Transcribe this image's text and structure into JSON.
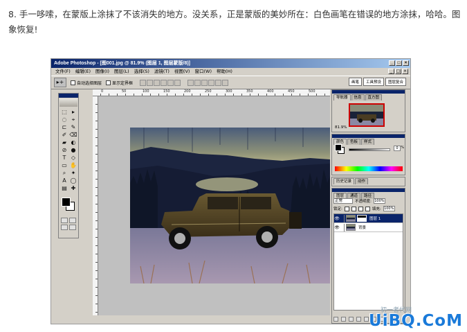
{
  "caption": "8. 手一哆嗦，在蒙版上涂抹了不该消失的地方。没关系，正是蒙版的美妙所在：白色画笔在错误的地方涂抹，哈哈。图象恢复!",
  "window": {
    "title": "Adobe Photoshop - [图001.jpg @ 81.9% (图层 1, 图层蒙版/8)]",
    "controls": [
      "_",
      "□",
      "×"
    ]
  },
  "menu": [
    "文件(F)",
    "编辑(E)",
    "图像(I)",
    "图层(L)",
    "选择(S)",
    "滤镜(T)",
    "视图(V)",
    "窗口(W)",
    "帮助(H)"
  ],
  "options_bar": {
    "tool_glyph": "▸+",
    "auto_select_label": "自动选择图层",
    "show_bounds_label": "显示定界框",
    "palette_well": [
      "画笔",
      "工具预设",
      "图层复合"
    ]
  },
  "tools": [
    "⬚",
    "▸",
    "◌",
    "⌖",
    "⊏",
    "✎",
    "✐",
    "⌫",
    "▰",
    "◐",
    "⊘",
    "●",
    "T",
    "◇",
    "▭",
    "✋",
    "⌕",
    "✦",
    "A",
    "◯",
    "▤",
    "✚"
  ],
  "ruler_ticks": [
    "0",
    "50",
    "100",
    "150",
    "200",
    "250",
    "300",
    "350",
    "400",
    "450",
    "500"
  ],
  "navigator": {
    "tabs": [
      "导航器",
      "信息",
      "直方图"
    ],
    "zoom": "81.9%"
  },
  "color_panel": {
    "tabs": [
      "颜色",
      "色板",
      "样式"
    ],
    "channel_value": "0",
    "channel_unit": "%"
  },
  "history_panel": {
    "tabs": [
      "历史记录",
      "动作"
    ]
  },
  "layers_panel": {
    "tabs": [
      "图层",
      "通道",
      "路径"
    ],
    "blend_mode": "正常",
    "opacity_label": "不透明度:",
    "opacity_value": "100%",
    "lock_label": "锁定:",
    "fill_label": "填充:",
    "fill_value": "100%",
    "layers": [
      {
        "name": "图层 1",
        "visible": "👁",
        "selected": true
      },
      {
        "name": "背景",
        "visible": "👁",
        "selected": false
      }
    ]
  },
  "watermark": {
    "text": "UiBQ.CoM",
    "sub": "初一者代网"
  },
  "colors": {
    "titlebar": "#0a246a",
    "watermark": "#1a7ad9",
    "selected_layer": "#0a246a"
  }
}
